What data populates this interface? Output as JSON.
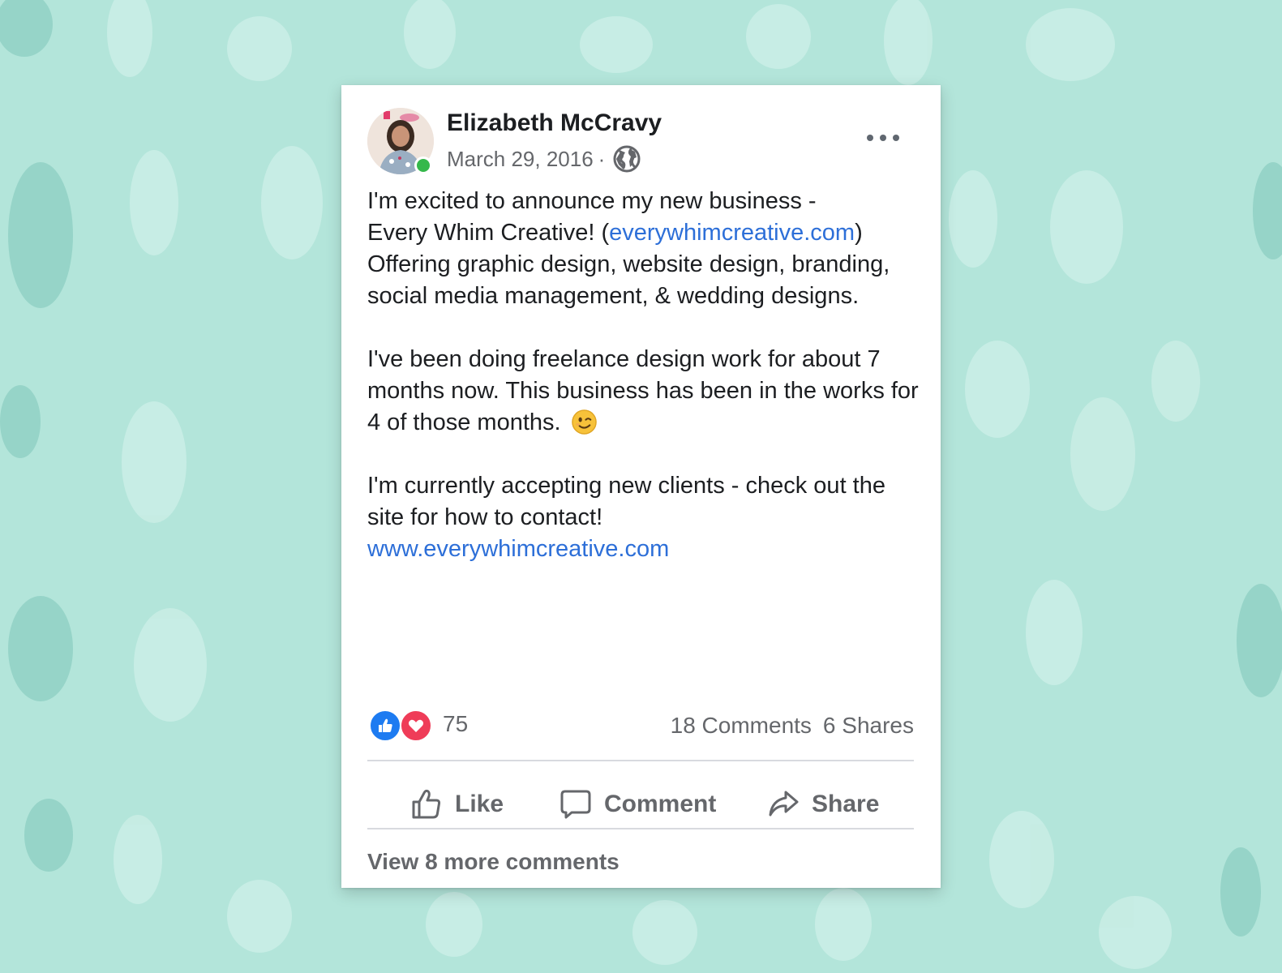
{
  "post": {
    "author": "Elizabeth McCravy",
    "date": "March 29, 2016",
    "date_separator": "·",
    "audience_icon": "globe-icon",
    "menu_icon": "more-options-icon",
    "paragraph1": {
      "line1": "I'm excited to announce my new business -",
      "line2_prefix": "Every Whim Creative! (",
      "link": "everywhimcreative.com",
      "line2_suffix": ")",
      "rest": "Offering graphic design, website design, branding, social media management, & wedding designs."
    },
    "paragraph2": {
      "text": "I've been doing freelance design work for about 7 months now. This business has been in the works for 4 of those months.",
      "emoji": "winking-face-emoji"
    },
    "paragraph3": {
      "text": "I'm currently accepting new clients - check out the site for how to contact!",
      "link": "www.everywhimcreative.com"
    }
  },
  "stats": {
    "reactions": [
      "like",
      "love"
    ],
    "reaction_count": "75",
    "comments": "18 Comments",
    "shares": "6 Shares"
  },
  "actions": {
    "like": "Like",
    "comment": "Comment",
    "share": "Share"
  },
  "view_more_comments": "View 8 more comments",
  "colors": {
    "background": "#b3e5da",
    "link": "#2d6fd8",
    "like_blue": "#1d7bf1",
    "love_red": "#ef3c58",
    "online_green": "#35b84b",
    "muted_text": "#65676b"
  }
}
